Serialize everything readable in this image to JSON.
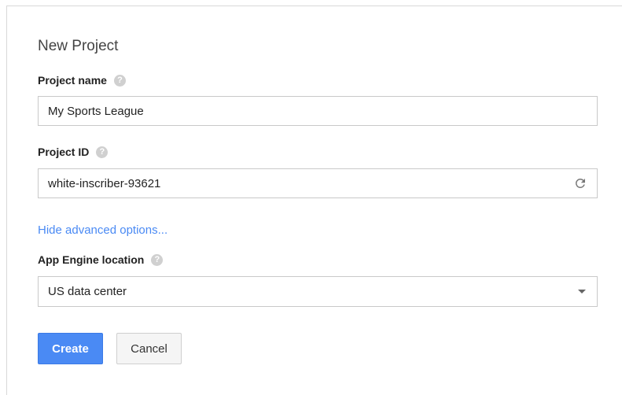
{
  "dialog": {
    "title": "New Project",
    "project_name": {
      "label": "Project name",
      "help_glyph": "?",
      "value": "My Sports League"
    },
    "project_id": {
      "label": "Project ID",
      "help_glyph": "?",
      "value": "white-inscriber-93621",
      "refresh_icon": "refresh-icon"
    },
    "advanced_link": "Hide advanced options...",
    "app_engine_location": {
      "label": "App Engine location",
      "help_glyph": "?",
      "selected": "US data center"
    },
    "buttons": {
      "create": "Create",
      "cancel": "Cancel"
    }
  },
  "colors": {
    "accent": "#4a8af4",
    "border": "#c9c9c9",
    "help_icon": "#d0d0d0"
  }
}
